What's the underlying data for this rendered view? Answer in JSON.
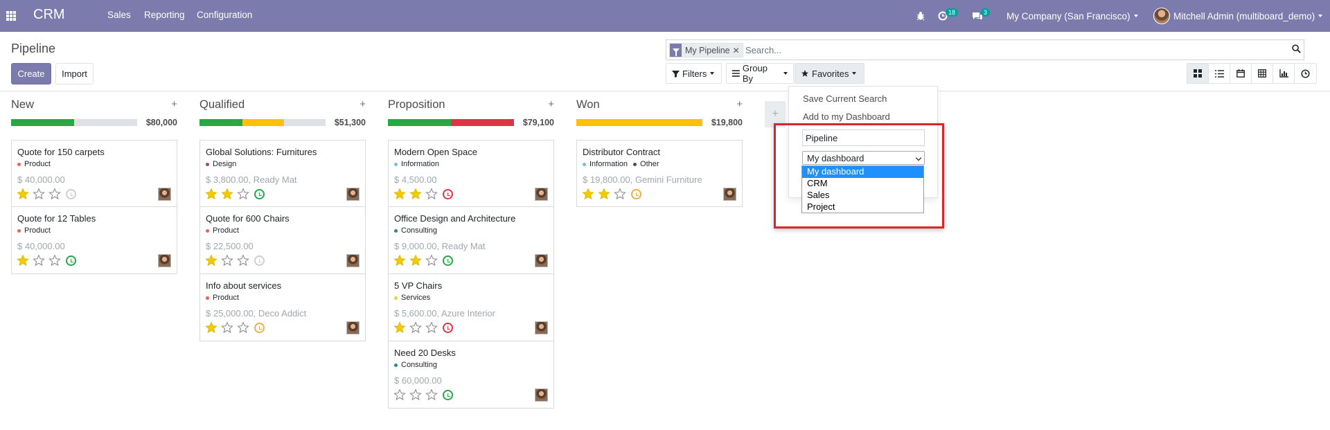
{
  "navbar": {
    "brand": "CRM",
    "menus": [
      "Sales",
      "Reporting",
      "Configuration"
    ],
    "activity_count": "18",
    "message_count": "3",
    "company": "My Company (San Francisco)",
    "user": "Mitchell Admin (multiboard_demo)"
  },
  "control_panel": {
    "title": "Pipeline",
    "create_label": "Create",
    "import_label": "Import",
    "facet_label": "My Pipeline",
    "search_placeholder": "Search...",
    "filters_label": "Filters",
    "groupby_label": "Group By",
    "favorites_label": "Favorites"
  },
  "columns": [
    {
      "name": "New",
      "total": "$80,000",
      "progress": [
        {
          "color": "#28a745",
          "fraction": 0.5
        },
        {
          "color": "#dee2e6",
          "fraction": 0.5
        }
      ],
      "cards": [
        {
          "title": "Quote for 150 carpets",
          "tags": [
            {
              "label": "Product",
              "color": "#f06050"
            }
          ],
          "amount": "$ 40,000.00",
          "stars": 1,
          "activity": "none"
        },
        {
          "title": "Quote for 12 Tables",
          "tags": [
            {
              "label": "Product",
              "color": "#f06050"
            }
          ],
          "amount": "$ 40,000.00",
          "stars": 1,
          "activity": "green"
        }
      ]
    },
    {
      "name": "Qualified",
      "total": "$51,300",
      "progress": [
        {
          "color": "#28a745",
          "fraction": 0.34
        },
        {
          "color": "#ffc107",
          "fraction": 0.33
        },
        {
          "color": "#dee2e6",
          "fraction": 0.33
        }
      ],
      "cards": [
        {
          "title": "Global Solutions: Furnitures",
          "tags": [
            {
              "label": "Design",
              "color": "#a24689"
            }
          ],
          "amount": "$ 3,800.00, Ready Mat",
          "stars": 2,
          "activity": "green"
        },
        {
          "title": "Quote for 600 Chairs",
          "tags": [
            {
              "label": "Product",
              "color": "#f06050"
            }
          ],
          "amount": "$ 22,500.00",
          "stars": 1,
          "activity": "none"
        },
        {
          "title": "Info about services",
          "tags": [
            {
              "label": "Product",
              "color": "#f06050"
            }
          ],
          "amount": "$ 25,000.00, Deco Addict",
          "stars": 1,
          "activity": "orange"
        }
      ]
    },
    {
      "name": "Proposition",
      "total": "$79,100",
      "progress": [
        {
          "color": "#28a745",
          "fraction": 0.5
        },
        {
          "color": "#dc3545",
          "fraction": 0.5
        }
      ],
      "cards": [
        {
          "title": "Modern Open Space",
          "tags": [
            {
              "label": "Information",
              "color": "#6cc1ed"
            }
          ],
          "amount": "$ 4,500.00",
          "stars": 2,
          "activity": "red"
        },
        {
          "title": "Office Design and Architecture",
          "tags": [
            {
              "label": "Consulting",
              "color": "#30838f"
            }
          ],
          "amount": "$ 9,000.00, Ready Mat",
          "stars": 2,
          "activity": "green"
        },
        {
          "title": "5 VP Chairs",
          "tags": [
            {
              "label": "Services",
              "color": "#f7cd1f"
            }
          ],
          "amount": "$ 5,600.00, Azure Interior",
          "stars": 1,
          "activity": "red"
        },
        {
          "title": "Need 20 Desks",
          "tags": [
            {
              "label": "Consulting",
              "color": "#30838f"
            }
          ],
          "amount": "$ 60,000.00",
          "stars": 0,
          "activity": "green"
        }
      ]
    },
    {
      "name": "Won",
      "total": "$19,800",
      "progress": [
        {
          "color": "#ffc107",
          "fraction": 1.0
        }
      ],
      "cards": [
        {
          "title": "Distributor Contract",
          "tags": [
            {
              "label": "Information",
              "color": "#6cc1ed"
            },
            {
              "label": "Other",
              "color": "#4c4c4c"
            }
          ],
          "amount": "$ 19,800.00, Gemini Furniture",
          "stars": 2,
          "activity": "orange"
        }
      ]
    }
  ],
  "favorites_menu": {
    "save_current_search": "Save Current Search",
    "add_to_dashboard": "Add to my Dashboard",
    "name_value": "Pipeline",
    "dashboard_selected": "My dashboard",
    "dashboard_options": [
      "My dashboard",
      "CRM",
      "Sales",
      "Project"
    ]
  },
  "colors": {
    "primary": "#7c7bad",
    "highlight_box": "#d9262c",
    "selected_option": "#1e90ff"
  }
}
